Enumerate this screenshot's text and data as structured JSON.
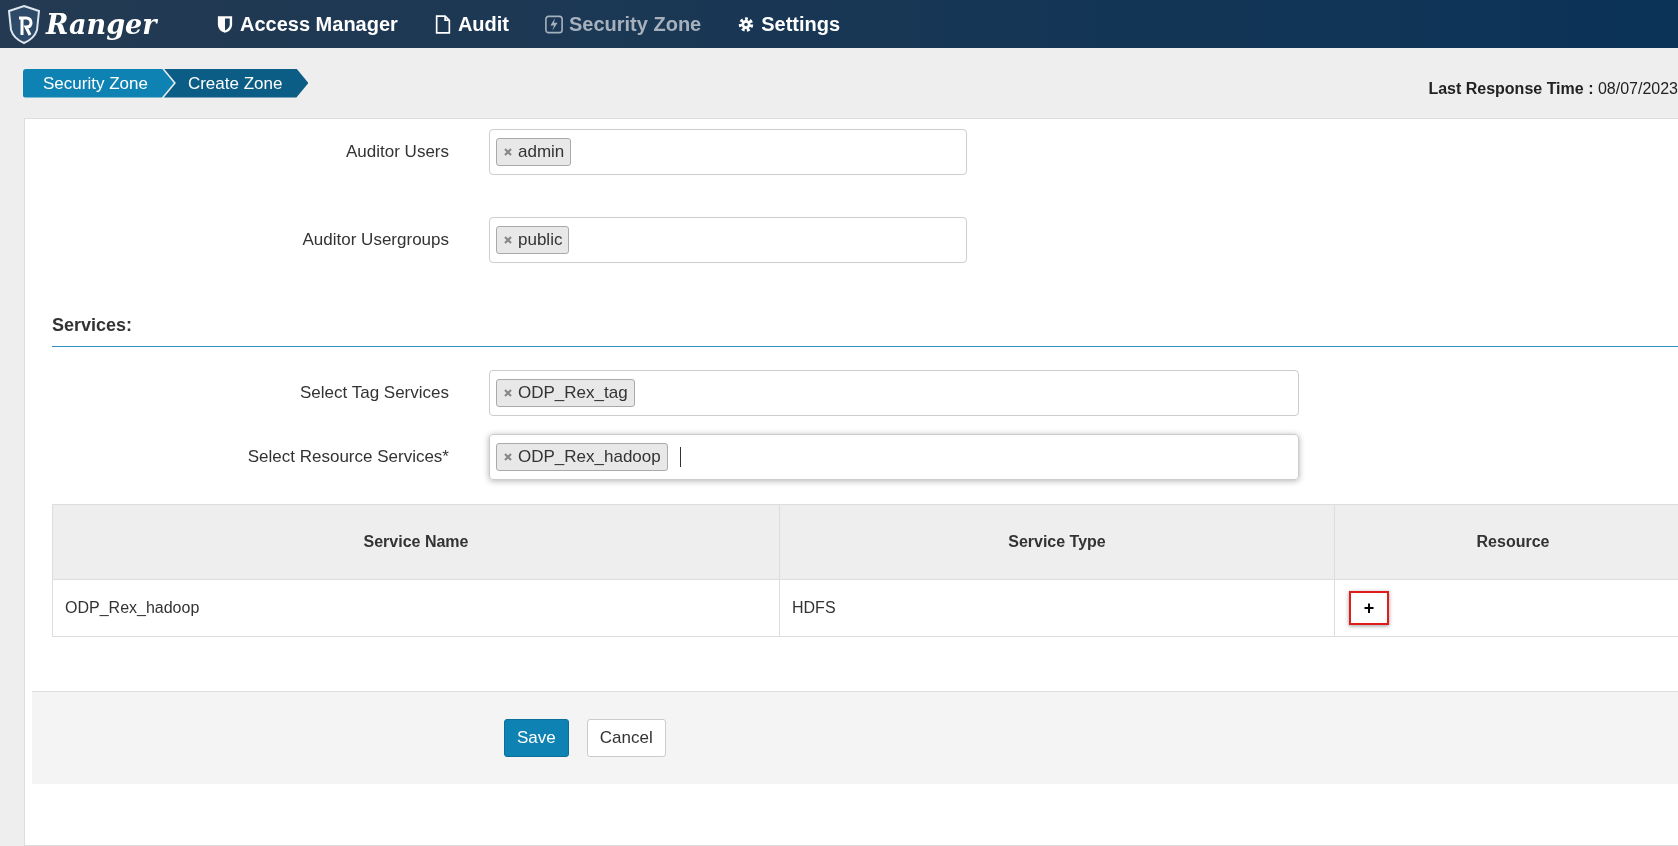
{
  "brand": {
    "name": "Ranger"
  },
  "nav": [
    {
      "label": "Access Manager",
      "selected": false
    },
    {
      "label": "Audit",
      "selected": false
    },
    {
      "label": "Security Zone",
      "selected": true
    },
    {
      "label": "Settings",
      "selected": false
    }
  ],
  "breadcrumb": [
    "Security Zone",
    "Create Zone"
  ],
  "last_response": {
    "label": "Last Response Time :",
    "value": "08/07/2023"
  },
  "fields": [
    {
      "label": "Auditor Users",
      "tags": [
        "admin"
      ],
      "focused": false
    },
    {
      "label": "Auditor Usergroups",
      "tags": [
        "public"
      ],
      "focused": false
    }
  ],
  "services": {
    "heading": "Services:",
    "fields": [
      {
        "label": "Select Tag Services",
        "tags": [
          "ODP_Rex_tag"
        ],
        "focused": false
      },
      {
        "label": "Select Resource Services*",
        "tags": [
          "ODP_Rex_hadoop"
        ],
        "focused": true
      }
    ],
    "table": {
      "columns": [
        "Service Name",
        "Service Type",
        "Resource"
      ],
      "rows": [
        {
          "service_name": "ODP_Rex_hadoop",
          "service_type": "HDFS",
          "add_button": {
            "label": "+",
            "highlighted": true
          }
        }
      ]
    }
  },
  "buttons": [
    {
      "label": "Save",
      "kind": "primary"
    },
    {
      "label": "Cancel",
      "kind": "default"
    }
  ]
}
